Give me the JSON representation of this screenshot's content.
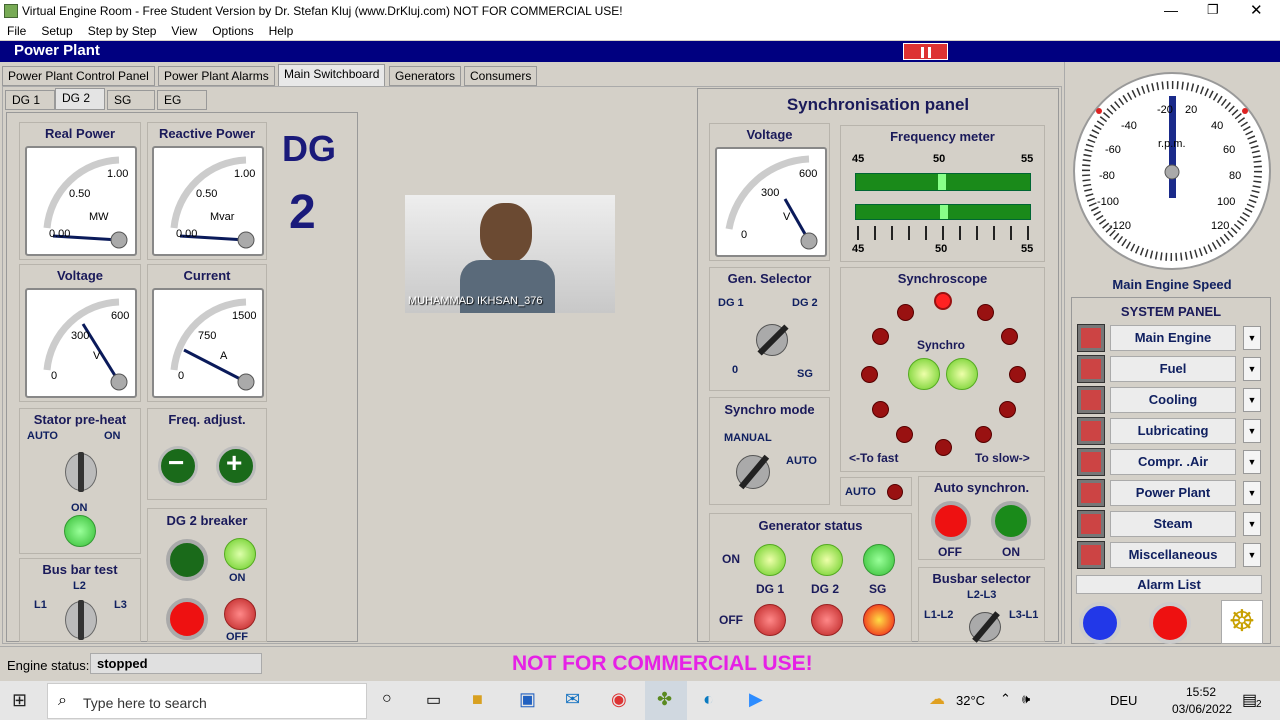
{
  "window": {
    "title": "Virtual Engine Room - Free Student Version by Dr. Stefan Kluj (www.DrKluj.com)  NOT FOR COMMERCIAL USE!"
  },
  "menu": [
    "File",
    "Setup",
    "Step by Step",
    "View",
    "Options",
    "Help"
  ],
  "header": {
    "title": "Power Plant"
  },
  "tabs": [
    "Power Plant Control Panel",
    "Power Plant Alarms",
    "Main Switchboard",
    "Generators",
    "Consumers"
  ],
  "subtabs": [
    "DG 1",
    "DG 2",
    "SG",
    "EG"
  ],
  "left": {
    "big_label": "DG",
    "big_number": "2",
    "real_power": {
      "title": "Real Power",
      "max": "1.00",
      "mid": "0.50",
      "min": "0.00",
      "unit": "MW"
    },
    "reactive_power": {
      "title": "Reactive Power",
      "max": "1.00",
      "mid": "0.50",
      "min": "0.00",
      "unit": "Mvar"
    },
    "voltage": {
      "title": "Voltage",
      "max": "600",
      "mid": "300",
      "min": "0",
      "unit": "V"
    },
    "current": {
      "title": "Current",
      "max": "1500",
      "mid": "750",
      "min": "0",
      "unit": "A"
    },
    "stator": {
      "title": "Stator pre-heat",
      "auto": "AUTO",
      "on": "ON",
      "on_label": "ON"
    },
    "freq": {
      "title": "Freq. adjust."
    },
    "breaker": {
      "title": "DG 2 breaker",
      "on": "ON",
      "off": "OFF"
    },
    "busbar": {
      "title": "Bus bar test",
      "l2": "L2",
      "l1": "L1",
      "l3": "L3"
    }
  },
  "video": {
    "name": "MUHAMMAD IKHSAN_376"
  },
  "sync": {
    "title": "Synchronisation panel",
    "voltage": {
      "title": "Voltage",
      "max": "600",
      "mid": "300",
      "min": "0",
      "unit": "V"
    },
    "freq": {
      "title": "Frequency meter",
      "t45": "45",
      "t50": "50",
      "t55": "55",
      "b45": "45",
      "b50": "50",
      "b55": "55"
    },
    "gen_selector": {
      "title": "Gen. Selector",
      "dg1": "DG 1",
      "dg2": "DG 2",
      "zero": "0",
      "sg": "SG"
    },
    "synchroscope": {
      "title": "Synchroscope",
      "synchro": "Synchro",
      "fast": "<-To fast",
      "slow": "To slow->"
    },
    "synchro_mode": {
      "title": "Synchro mode",
      "manual": "MANUAL",
      "auto": "AUTO"
    },
    "auto_label": "AUTO",
    "auto_synch": {
      "title": "Auto synchron.",
      "off": "OFF",
      "on": "ON"
    },
    "gen_status": {
      "title": "Generator status",
      "on": "ON",
      "off": "OFF",
      "dg1": "DG 1",
      "dg2": "DG 2",
      "sg": "SG"
    },
    "busbar_selector": {
      "title": "Busbar selector",
      "l2l3": "L2-L3",
      "l1l2": "L1-L2",
      "l3l1": "L3-L1"
    }
  },
  "rpm": {
    "title": "Main Engine Speed",
    "unit": "r.p.m.",
    "ticks": [
      "-20",
      "20",
      "-40",
      "40",
      "-60",
      "60",
      "-80",
      "80",
      "-100",
      "100",
      "-120",
      "120"
    ]
  },
  "system_panel": {
    "title": "SYSTEM PANEL",
    "items": [
      "Main Engine",
      "Fuel",
      "Cooling",
      "Lubricating",
      "Compr. .Air",
      "Power Plant",
      "Steam",
      "Miscellaneous"
    ],
    "alarm": "Alarm List"
  },
  "status": {
    "label": "Engine status:",
    "value": "stopped",
    "warning": "NOT FOR COMMERCIAL USE!"
  },
  "taskbar": {
    "search": "Type here to search",
    "temp": "32°C",
    "lang": "DEU",
    "time": "15:52",
    "date": "03/06/2022",
    "notif": "2"
  }
}
